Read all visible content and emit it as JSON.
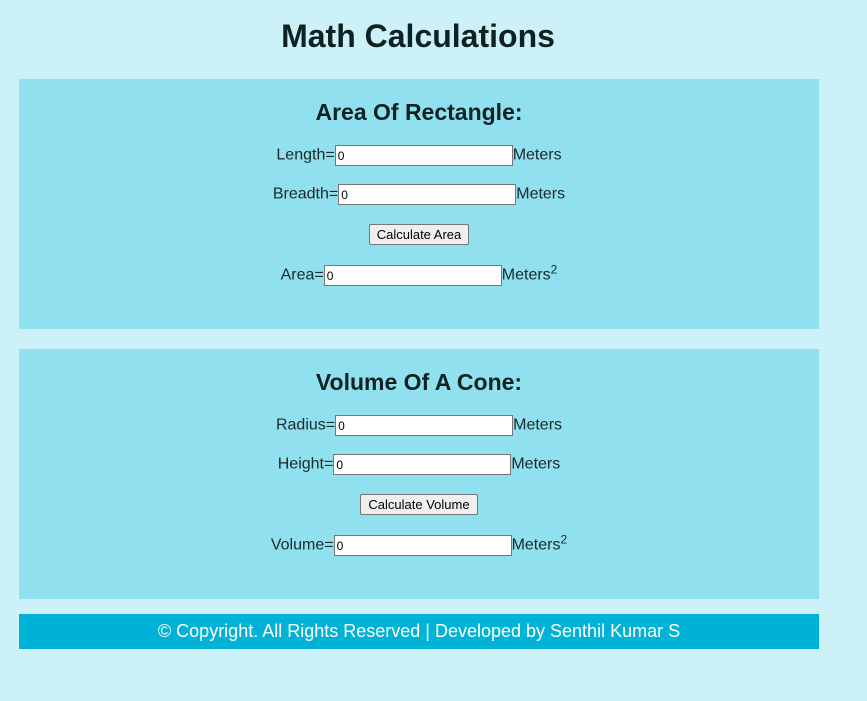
{
  "page": {
    "title": "Math Calculations"
  },
  "rectangle": {
    "heading": "Area Of Rectangle:",
    "length_label": "Length=",
    "length_value": "0",
    "length_unit": "Meters",
    "breadth_label": "Breadth=",
    "breadth_value": "0",
    "breadth_unit": "Meters",
    "button_label": "Calculate Area",
    "area_label": "Area=",
    "area_value": "0",
    "area_unit": "Meters",
    "area_exponent": "2"
  },
  "cone": {
    "heading": "Volume Of A Cone:",
    "radius_label": "Radius=",
    "radius_value": "0",
    "radius_unit": "Meters",
    "height_label": "Height=",
    "height_value": "0",
    "height_unit": "Meters",
    "button_label": "Calculate Volume",
    "volume_label": "Volume=",
    "volume_value": "0",
    "volume_unit": "Meters",
    "volume_exponent": "2"
  },
  "footer": {
    "text": "© Copyright. All Rights Reserved | Developed by Senthil Kumar S"
  },
  "colors": {
    "background": "#ccf1f8",
    "panel": "#91e0ef",
    "footer": "#00b3d6",
    "text": "#1b2a2a"
  }
}
